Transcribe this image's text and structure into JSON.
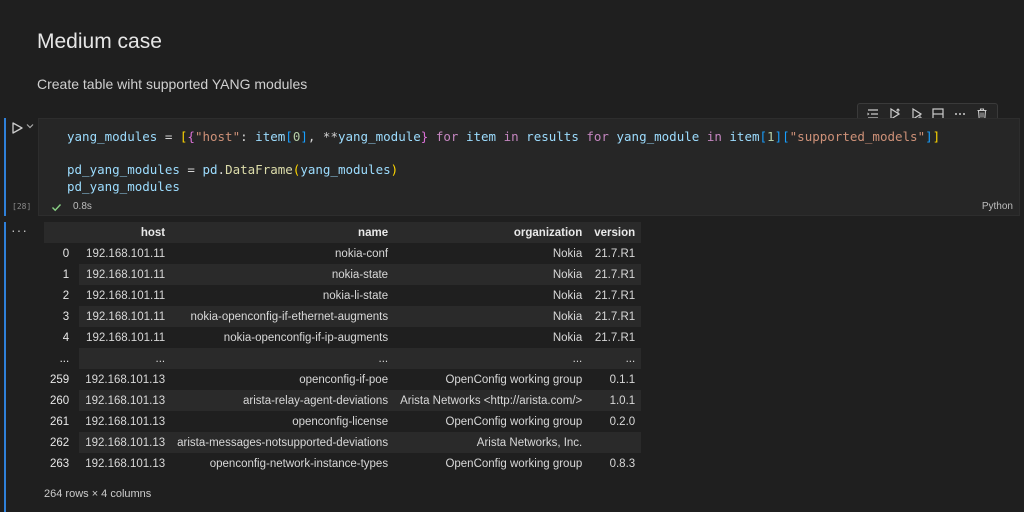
{
  "markdown": {
    "heading": "Medium case",
    "text": "Create table wiht supported YANG modules"
  },
  "cell": {
    "execution_count": "[28]",
    "duration": "0.8s",
    "language": "Python",
    "code": {
      "line1": {
        "var": "yang_modules",
        "op": " = ",
        "b1": "[",
        "b2": "{",
        "s_host": "\"host\"",
        "colon": ": ",
        "item": "item",
        "b3a": "[",
        "zero": "0",
        "b3b": "]",
        "rest1": ", **",
        "ym": "yang_module",
        "b2c": "}",
        "for1": " for ",
        "item2": "item",
        "in1": " in ",
        "results": "results",
        "for2": " for ",
        "ym2": "yang_module",
        "in2": " in ",
        "item3": "item",
        "b3c": "[",
        "one": "1",
        "b3d": "][",
        "s_sm": "\"supported_models\"",
        "b3e": "]",
        "b1c": "]"
      },
      "line2": {
        "var": "pd_yang_modules",
        "op": " = ",
        "pd": "pd",
        "dot": ".",
        "fn": "DataFrame",
        "open": "(",
        "arg": "yang_modules",
        "close": ")"
      },
      "line3": "pd_yang_modules"
    }
  },
  "toolbar": {
    "icons": [
      "run-by-line-icon",
      "execute-above-icon",
      "execute-below-icon",
      "split-cell-icon",
      "more-icon",
      "delete-icon"
    ]
  },
  "output": {
    "more_label": "···",
    "table": {
      "columns": [
        "",
        "host",
        "name",
        "organization",
        "version"
      ],
      "rows": [
        [
          "0",
          "192.168.101.11",
          "nokia-conf",
          "Nokia",
          "21.7.R1"
        ],
        [
          "1",
          "192.168.101.11",
          "nokia-state",
          "Nokia",
          "21.7.R1"
        ],
        [
          "2",
          "192.168.101.11",
          "nokia-li-state",
          "Nokia",
          "21.7.R1"
        ],
        [
          "3",
          "192.168.101.11",
          "nokia-openconfig-if-ethernet-augments",
          "Nokia",
          "21.7.R1"
        ],
        [
          "4",
          "192.168.101.11",
          "nokia-openconfig-if-ip-augments",
          "Nokia",
          "21.7.R1"
        ],
        [
          "...",
          "...",
          "...",
          "...",
          "..."
        ],
        [
          "259",
          "192.168.101.13",
          "openconfig-if-poe",
          "OpenConfig working group",
          "0.1.1"
        ],
        [
          "260",
          "192.168.101.13",
          "arista-relay-agent-deviations",
          "Arista Networks <http://arista.com/>",
          "1.0.1"
        ],
        [
          "261",
          "192.168.101.13",
          "openconfig-license",
          "OpenConfig working group",
          "0.2.0"
        ],
        [
          "262",
          "192.168.101.13",
          "arista-messages-notsupported-deviations",
          "Arista Networks, Inc.",
          ""
        ],
        [
          "263",
          "192.168.101.13",
          "openconfig-network-instance-types",
          "OpenConfig working group",
          "0.8.3"
        ]
      ]
    },
    "shape": "264 rows × 4 columns"
  },
  "colors": {
    "accent": "#2f80d9",
    "background": "#1f1f1f"
  }
}
